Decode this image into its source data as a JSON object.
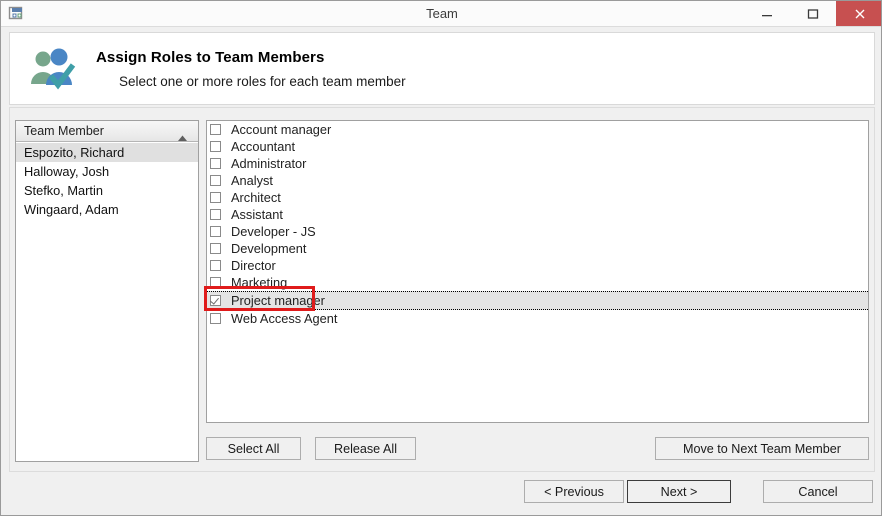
{
  "window": {
    "title": "Team",
    "icon": "team-window-icon",
    "minimize_label": "Minimize",
    "maximize_label": "Maximize",
    "close_label": "Close",
    "close_button_color": "#c75050"
  },
  "header": {
    "icon": "people-check-icon",
    "title": "Assign Roles to Team Members",
    "subtitle": "Select one or more roles for each team member"
  },
  "member_list": {
    "column_header": "Team Member",
    "sort_icon": "sort-ascending-arrow-icon",
    "items": [
      {
        "name": "Espozito, Richard",
        "selected": true
      },
      {
        "name": "Halloway, Josh",
        "selected": false
      },
      {
        "name": "Stefko, Martin",
        "selected": false
      },
      {
        "name": "Wingaard, Adam",
        "selected": false
      }
    ]
  },
  "roles_list": {
    "items": [
      {
        "label": "Account manager",
        "checked": false
      },
      {
        "label": "Accountant",
        "checked": false
      },
      {
        "label": "Administrator",
        "checked": false
      },
      {
        "label": "Analyst",
        "checked": false
      },
      {
        "label": "Architect",
        "checked": false
      },
      {
        "label": "Assistant",
        "checked": false
      },
      {
        "label": "Developer - JS",
        "checked": false
      },
      {
        "label": "Development",
        "checked": false
      },
      {
        "label": "Director",
        "checked": false
      },
      {
        "label": "Marketing",
        "checked": false
      },
      {
        "label": "Project manager",
        "checked": true
      },
      {
        "label": "Web Access Agent",
        "checked": false
      }
    ]
  },
  "buttons": {
    "select_all": "Select All",
    "release_all": "Release All",
    "move_next": "Move to Next Team Member",
    "previous": "< Previous",
    "next": "Next >",
    "cancel": "Cancel"
  },
  "annotation": {
    "target": "Project manager",
    "color": "#e01b1b"
  }
}
